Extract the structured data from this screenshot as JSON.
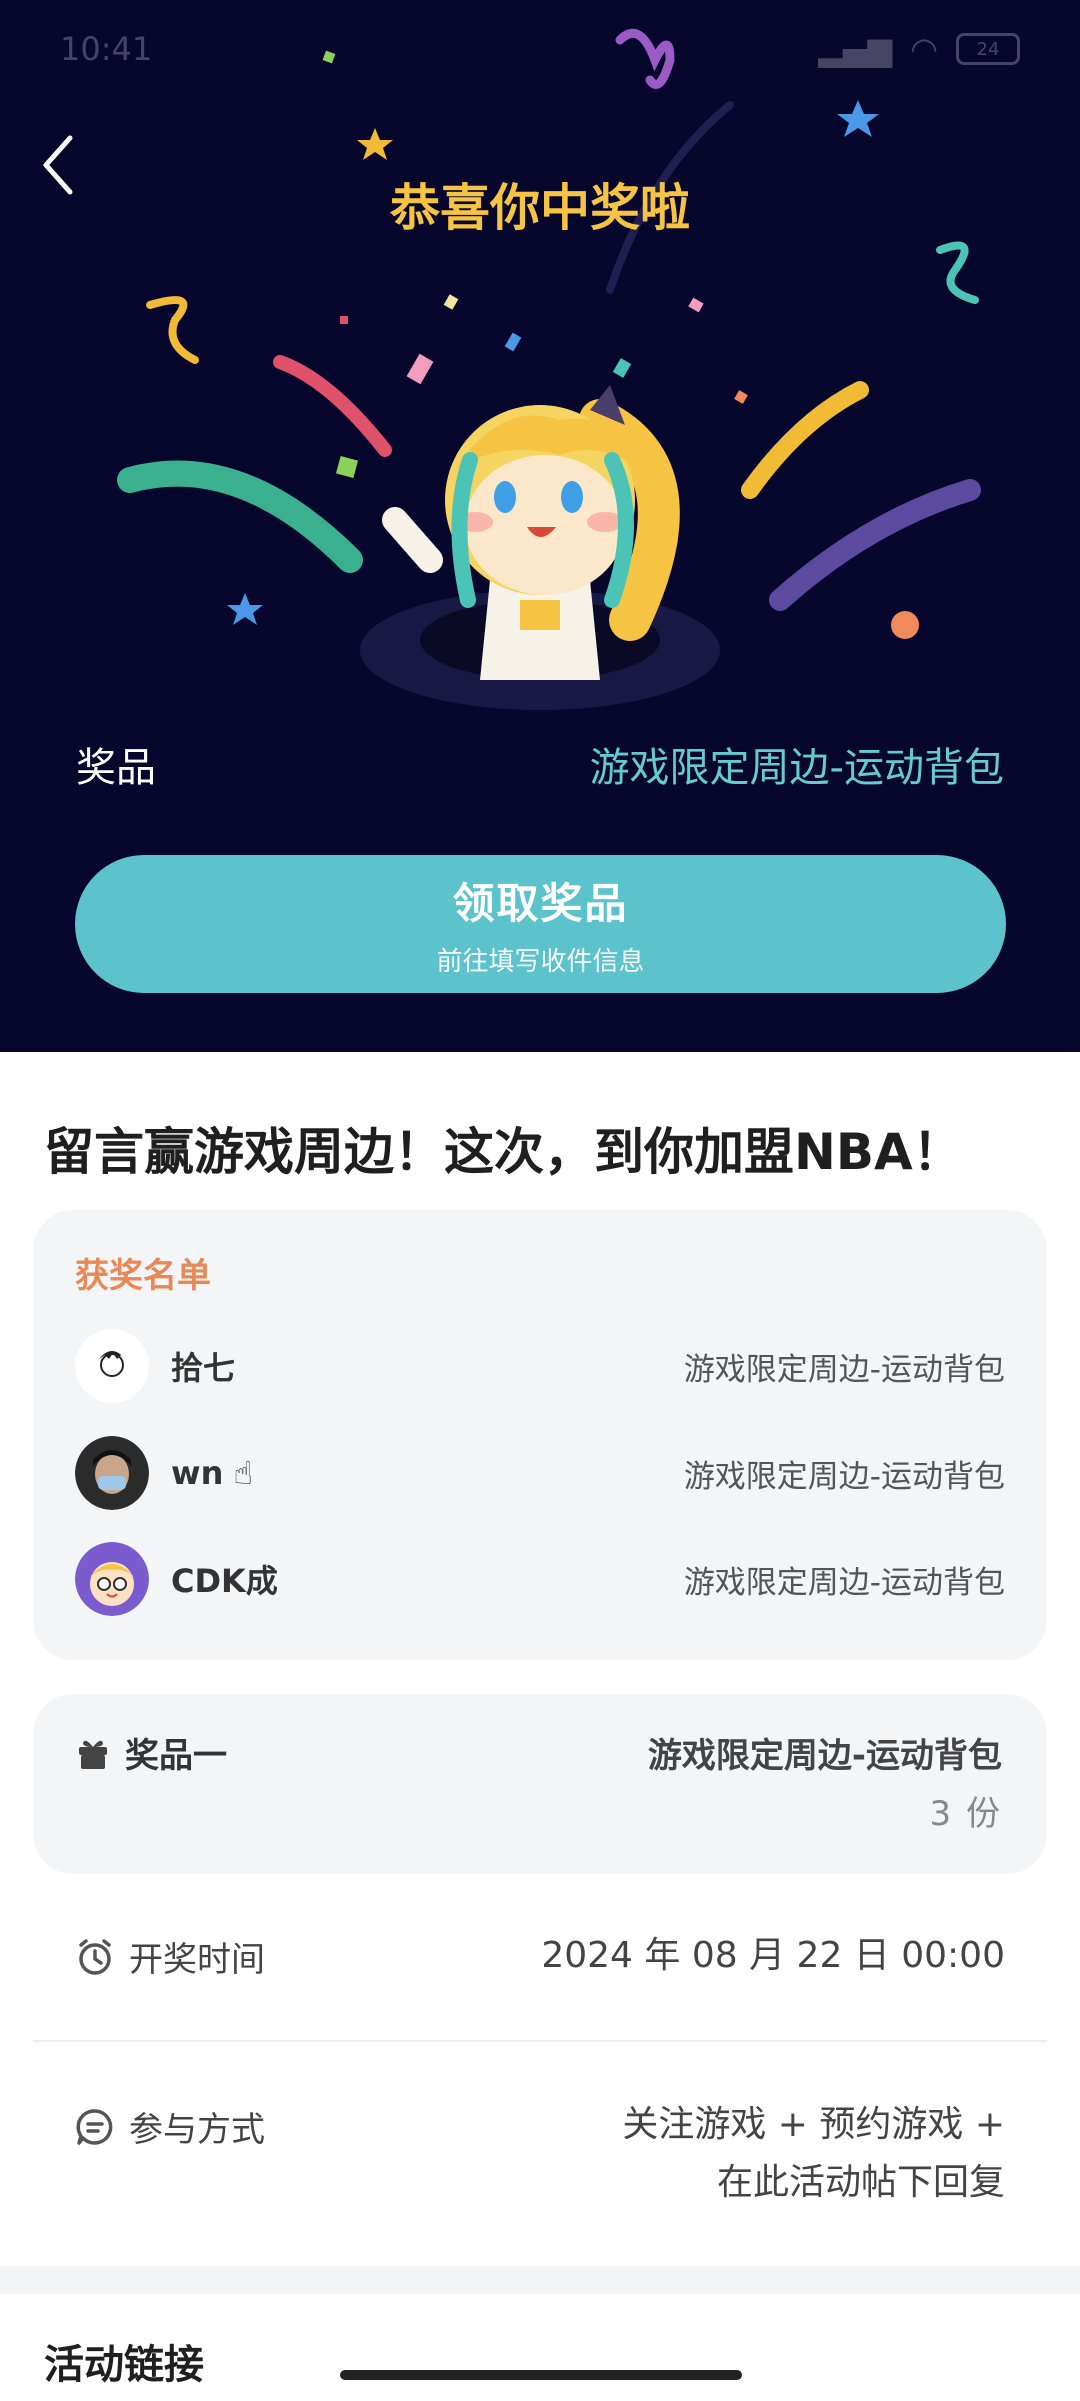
{
  "status_bar": {
    "time": "10:41",
    "battery": "24"
  },
  "hero": {
    "title": "恭喜你中奖啦",
    "prize_label": "奖品",
    "prize_value": "游戏限定周边-运动背包",
    "claim_button": {
      "label": "领取奖品",
      "sub_label": "前往填写收件信息"
    },
    "background_color": "#07072e",
    "accent_color": "#5cc2cc"
  },
  "post": {
    "title": "留言赢游戏周边！这次，到你加盟NBA！"
  },
  "winners": {
    "title": "获奖名单",
    "items": [
      {
        "name": "拾七",
        "prize": "游戏限定周边-运动背包"
      },
      {
        "name": "wn",
        "prize": "游戏限定周边-运动背包"
      },
      {
        "name": "CDK成",
        "prize": "游戏限定周边-运动背包"
      }
    ]
  },
  "prize_info": {
    "label": "奖品一",
    "value": "游戏限定周边-运动背包",
    "count": "3 份"
  },
  "draw_time": {
    "label": "开奖时间",
    "value": "2024 年 08 月 22 日 00:00"
  },
  "participation": {
    "label": "参与方式",
    "line1": "关注游戏 + 预约游戏 +",
    "line2": "在此活动帖下回复"
  },
  "links": {
    "title": "活动链接"
  }
}
